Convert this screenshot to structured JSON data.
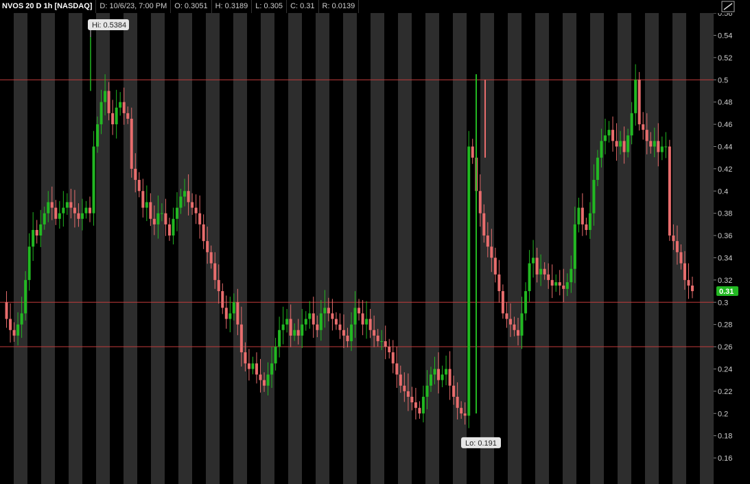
{
  "header": {
    "symbol": "NVOS 20 D 1h [NASDAQ]",
    "date": "D: 10/6/23, 7:00 PM",
    "open": "O: 0.3051",
    "high": "H: 0.3189",
    "low": "L: 0.305",
    "close": "C: 0.31",
    "range": "R: 0.0139"
  },
  "icons": {
    "drawing_tool": "drawing-tool-icon"
  },
  "colors": {
    "background": "#000000",
    "session_band": "#2d2d2d",
    "up": "#22b822",
    "down": "#e86d6d",
    "level_line": "#c43c3c",
    "last_price_bg": "#22b822",
    "callout_bg": "#e6e6e6"
  },
  "chart_data": {
    "type": "candlestick",
    "interval": "1h",
    "days": 20,
    "y_ticks": [
      "0.56",
      "0.54",
      "0.52",
      "0.5",
      "0.48",
      "0.46",
      "0.44",
      "0.42",
      "0.4",
      "0.38",
      "0.36",
      "0.34",
      "0.32",
      "0.3",
      "0.28",
      "0.26",
      "0.24",
      "0.22",
      "0.2",
      "0.18",
      "0.16"
    ],
    "ylim": [
      0.155,
      0.57
    ],
    "horizontal_levels": [
      0.5,
      0.3,
      0.26
    ],
    "high_callout": {
      "label": "Hi: 0.5384",
      "value": 0.5384
    },
    "low_callout": {
      "label": "Lo: 0.191",
      "value": 0.191
    },
    "last_price": {
      "label": "0.31",
      "value": 0.31
    },
    "close_path": [
      0.3,
      0.285,
      0.275,
      0.27,
      0.28,
      0.29,
      0.32,
      0.35,
      0.365,
      0.36,
      0.37,
      0.38,
      0.39,
      0.385,
      0.375,
      0.38,
      0.385,
      0.39,
      0.385,
      0.38,
      0.375,
      0.38,
      0.385,
      0.38,
      0.44,
      0.46,
      0.48,
      0.49,
      0.47,
      0.46,
      0.475,
      0.48,
      0.47,
      0.465,
      0.42,
      0.41,
      0.4,
      0.385,
      0.39,
      0.375,
      0.37,
      0.38,
      0.38,
      0.37,
      0.36,
      0.375,
      0.385,
      0.395,
      0.4,
      0.39,
      0.385,
      0.38,
      0.37,
      0.355,
      0.345,
      0.335,
      0.32,
      0.31,
      0.295,
      0.285,
      0.29,
      0.3,
      0.28,
      0.255,
      0.245,
      0.24,
      0.245,
      0.235,
      0.23,
      0.225,
      0.235,
      0.245,
      0.26,
      0.275,
      0.28,
      0.285,
      0.27,
      0.275,
      0.27,
      0.28,
      0.285,
      0.29,
      0.28,
      0.275,
      0.29,
      0.295,
      0.29,
      0.285,
      0.28,
      0.275,
      0.27,
      0.265,
      0.28,
      0.295,
      0.29,
      0.28,
      0.285,
      0.275,
      0.27,
      0.265,
      0.265,
      0.26,
      0.255,
      0.245,
      0.235,
      0.225,
      0.22,
      0.215,
      0.21,
      0.205,
      0.2,
      0.215,
      0.225,
      0.235,
      0.24,
      0.23,
      0.235,
      0.24,
      0.225,
      0.215,
      0.205,
      0.2,
      0.198,
      0.44,
      0.43,
      0.4,
      0.38,
      0.36,
      0.35,
      0.34,
      0.325,
      0.31,
      0.29,
      0.285,
      0.28,
      0.275,
      0.27,
      0.29,
      0.31,
      0.335,
      0.34,
      0.325,
      0.33,
      0.325,
      0.32,
      0.315,
      0.318,
      0.315,
      0.312,
      0.318,
      0.33,
      0.37,
      0.385,
      0.37,
      0.365,
      0.38,
      0.41,
      0.43,
      0.445,
      0.45,
      0.455,
      0.445,
      0.44,
      0.445,
      0.435,
      0.45,
      0.47,
      0.5,
      0.46,
      0.455,
      0.445,
      0.44,
      0.445,
      0.435,
      0.44,
      0.44,
      0.36,
      0.355,
      0.345,
      0.335,
      0.32,
      0.315,
      0.31
    ]
  }
}
